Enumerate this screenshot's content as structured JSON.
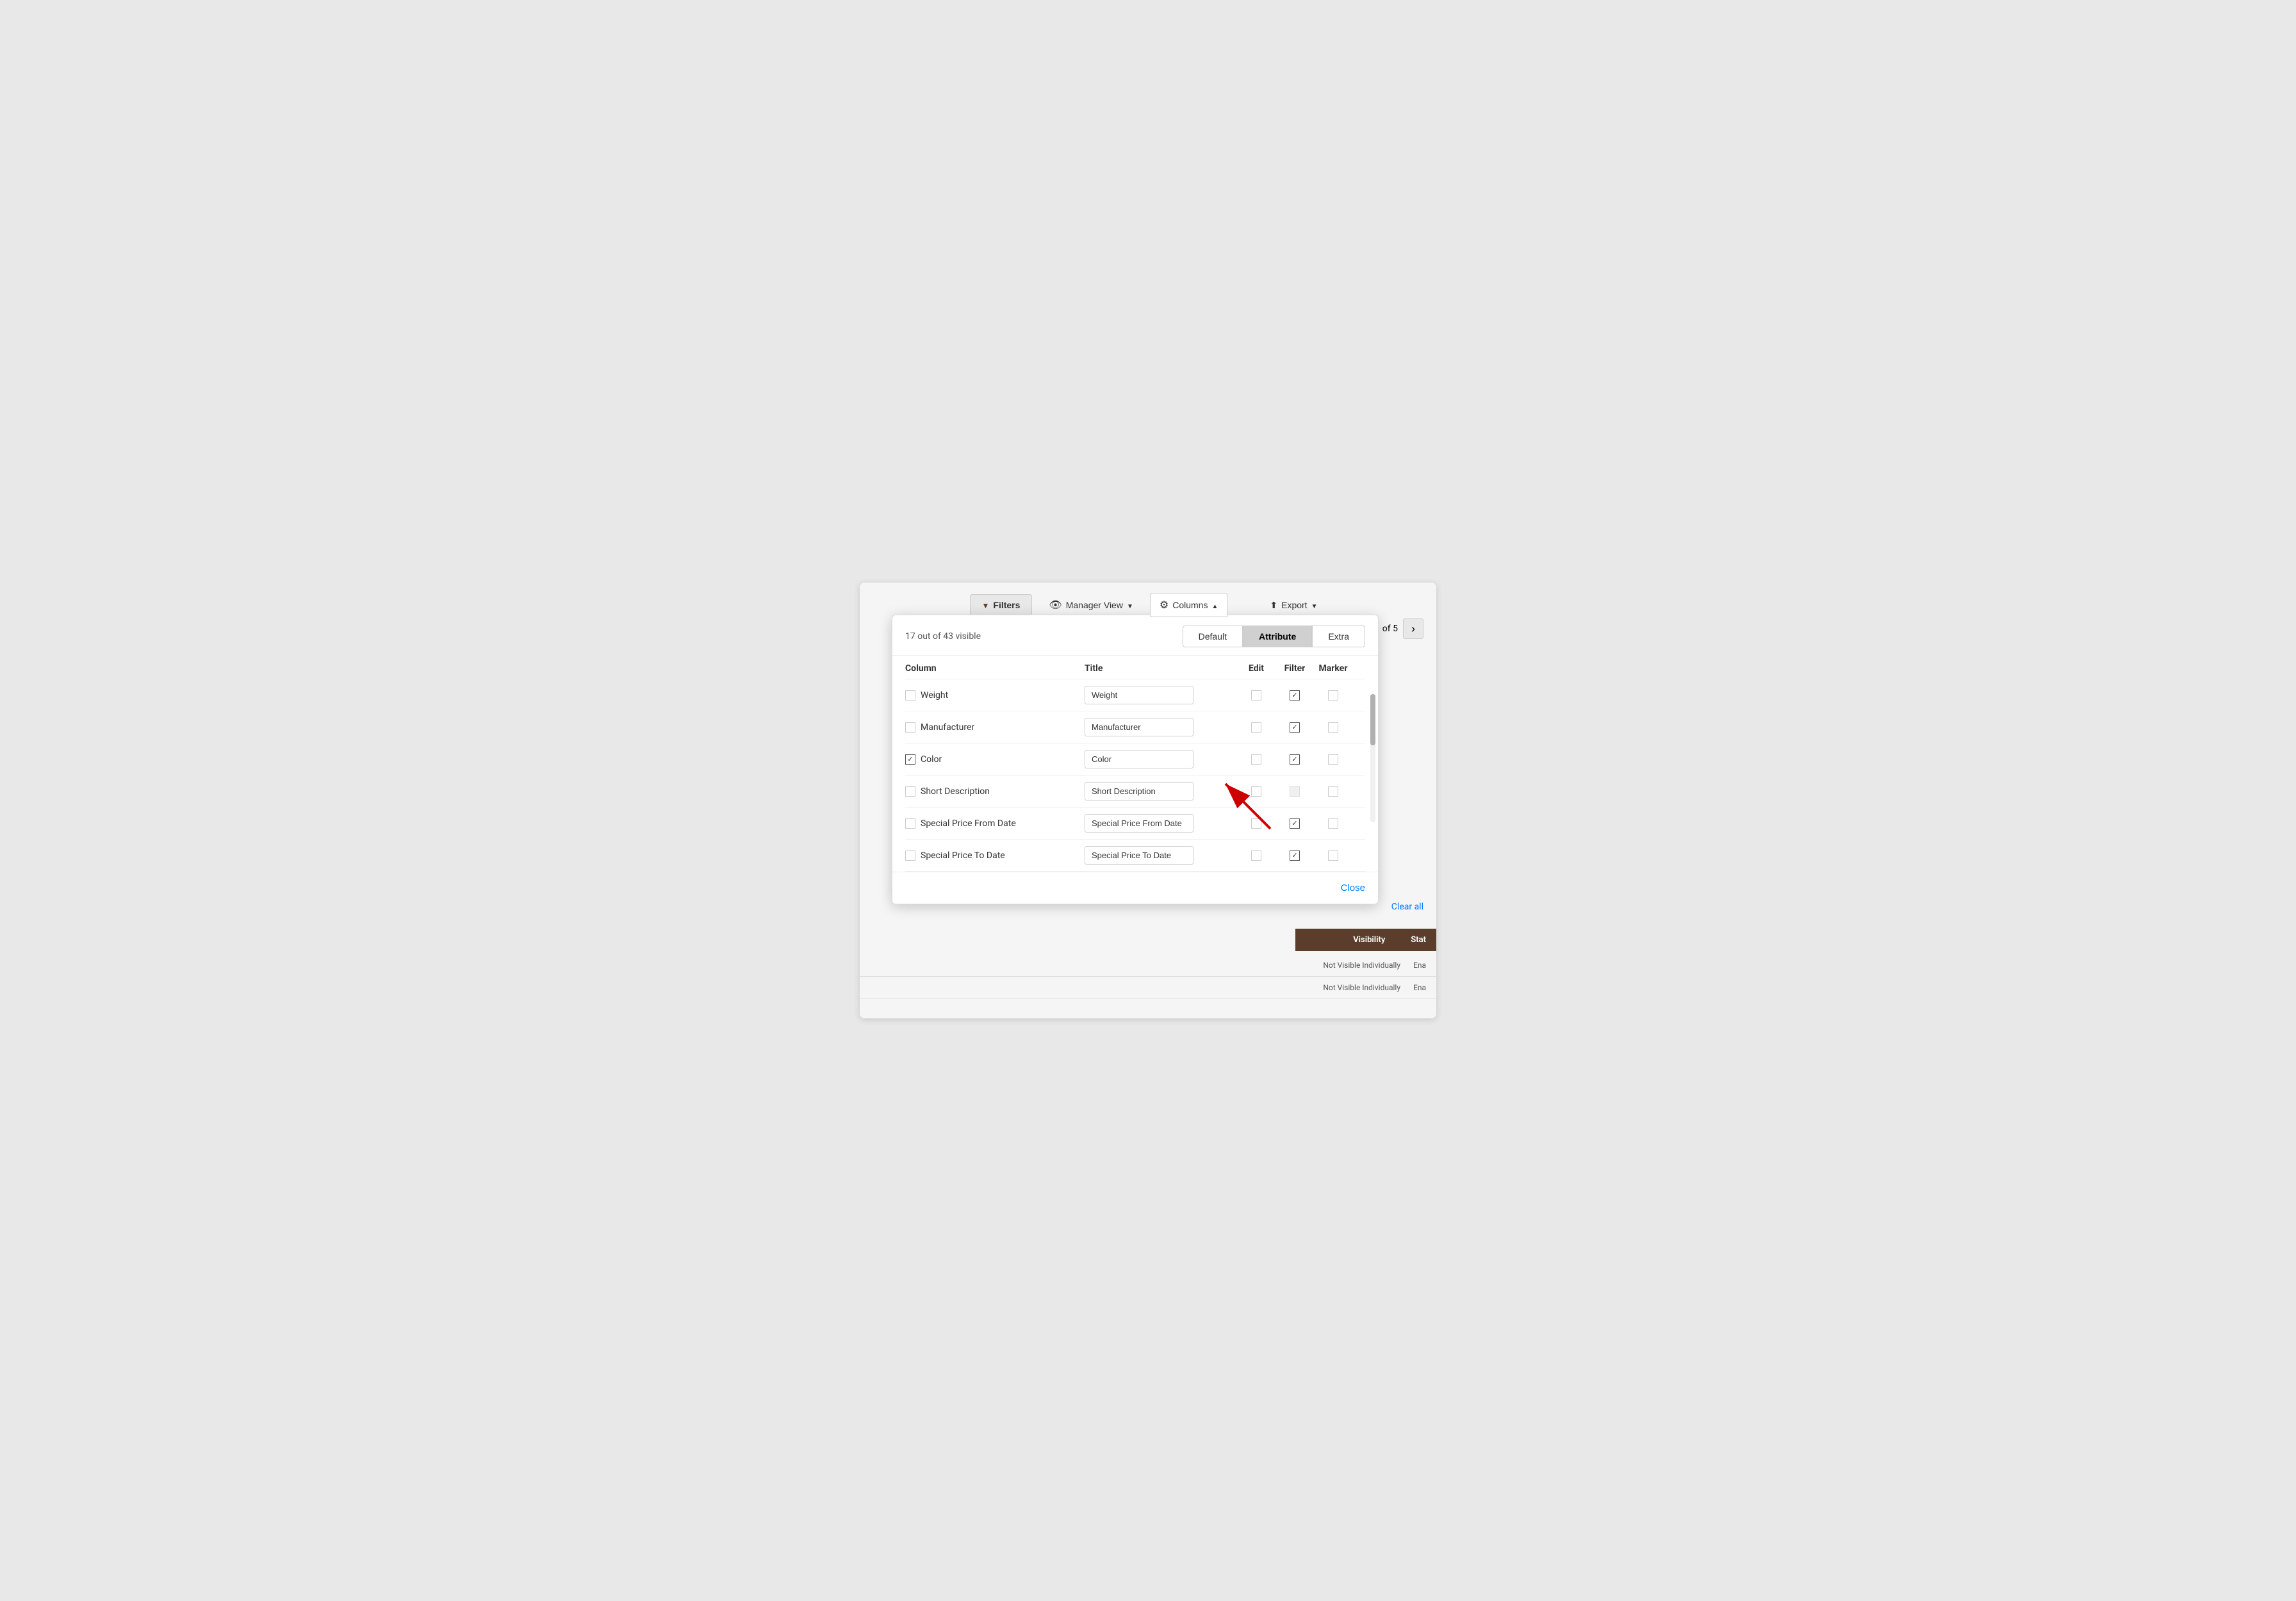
{
  "toolbar": {
    "filters_label": "Filters",
    "manager_view_label": "Manager View",
    "columns_label": "Columns",
    "export_label": "Export",
    "clear_all_label": "Clear all"
  },
  "pagination": {
    "of_text": "of 5"
  },
  "modal": {
    "visible_count": "17 out of 43 visible",
    "tabs": [
      {
        "id": "default",
        "label": "Default",
        "active": false
      },
      {
        "id": "attribute",
        "label": "Attribute",
        "active": true
      },
      {
        "id": "extra",
        "label": "Extra",
        "active": false
      }
    ],
    "table_headers": {
      "column": "Column",
      "title": "Title",
      "edit": "Edit",
      "filter": "Filter",
      "marker": "Marker"
    },
    "rows": [
      {
        "id": "weight",
        "name": "Weight",
        "title_value": "Weight",
        "col_checked": false,
        "edit_checked": false,
        "filter_checked": true,
        "marker_checked": false
      },
      {
        "id": "manufacturer",
        "name": "Manufacturer",
        "title_value": "Manufacturer",
        "col_checked": false,
        "edit_checked": false,
        "filter_checked": true,
        "marker_checked": false
      },
      {
        "id": "color",
        "name": "Color",
        "title_value": "Color",
        "col_checked": true,
        "edit_checked": false,
        "filter_checked": true,
        "marker_checked": false
      },
      {
        "id": "short-description",
        "name": "Short Description",
        "title_value": "Short Description",
        "col_checked": false,
        "edit_checked": false,
        "filter_checked": false,
        "marker_checked": false
      },
      {
        "id": "special-price-from",
        "name": "Special Price From Date",
        "title_value": "Special Price From Date",
        "col_checked": false,
        "edit_checked": false,
        "filter_checked": true,
        "marker_checked": false
      },
      {
        "id": "special-price-to",
        "name": "Special Price To Date",
        "title_value": "Special Price To Date",
        "col_checked": false,
        "edit_checked": false,
        "filter_checked": true,
        "marker_checked": false
      }
    ],
    "close_label": "Close"
  },
  "background_rows": [
    {
      "visibility": "Not Visible Individually",
      "status": "Ena"
    },
    {
      "visibility": "Not Visible Individually",
      "status": "Ena"
    }
  ],
  "bg_table_headers": {
    "visibility": "Visibility",
    "status": "Stat"
  }
}
